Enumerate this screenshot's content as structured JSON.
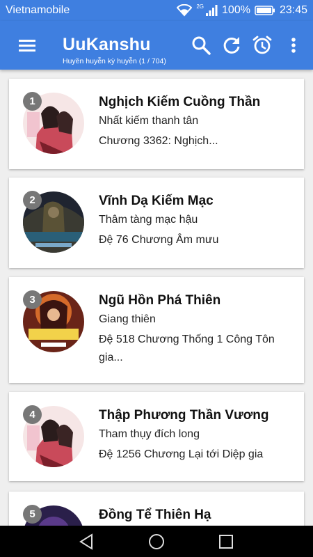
{
  "status_bar": {
    "carrier": "Vietnamobile",
    "network_type": "2G",
    "battery": "100%",
    "time": "23:45",
    "icons": [
      "wifi-icon",
      "signal-icon",
      "battery-icon"
    ]
  },
  "app_bar": {
    "title": "UuKanshu",
    "subtitle": "Huyền huyễn kỳ huyễn (1 / 704)",
    "background_color": "#3f7fe0",
    "actions": [
      "menu-icon",
      "search-icon",
      "refresh-icon",
      "alarm-icon",
      "more-vert-icon"
    ]
  },
  "books": [
    {
      "rank": "1",
      "title": "Nghịch Kiếm Cuồng Thần",
      "author": "Nhất kiếm thanh tân",
      "chapter": "Chương 3362: Nghịch..."
    },
    {
      "rank": "2",
      "title": "Vĩnh Dạ Kiếm Mạc",
      "author": "Thâm tàng mạc hậu",
      "chapter": "Đệ 76 Chương Âm mưu"
    },
    {
      "rank": "3",
      "title": "Ngũ Hồn Phá Thiên",
      "author": "Giang thiên",
      "chapter": "Đệ 518 Chương Thống 1 Công Tôn gia..."
    },
    {
      "rank": "4",
      "title": "Thập Phương Thần Vương",
      "author": "Tham thụy đích long",
      "chapter": "Đệ 1256 Chương Lại tới Diệp gia"
    },
    {
      "rank": "5",
      "title": "Đồng Tể Thiên Hạ",
      "author": "",
      "chapter": ""
    }
  ],
  "nav_bar": {
    "buttons": [
      "back-icon",
      "home-icon",
      "recent-apps-icon"
    ]
  }
}
